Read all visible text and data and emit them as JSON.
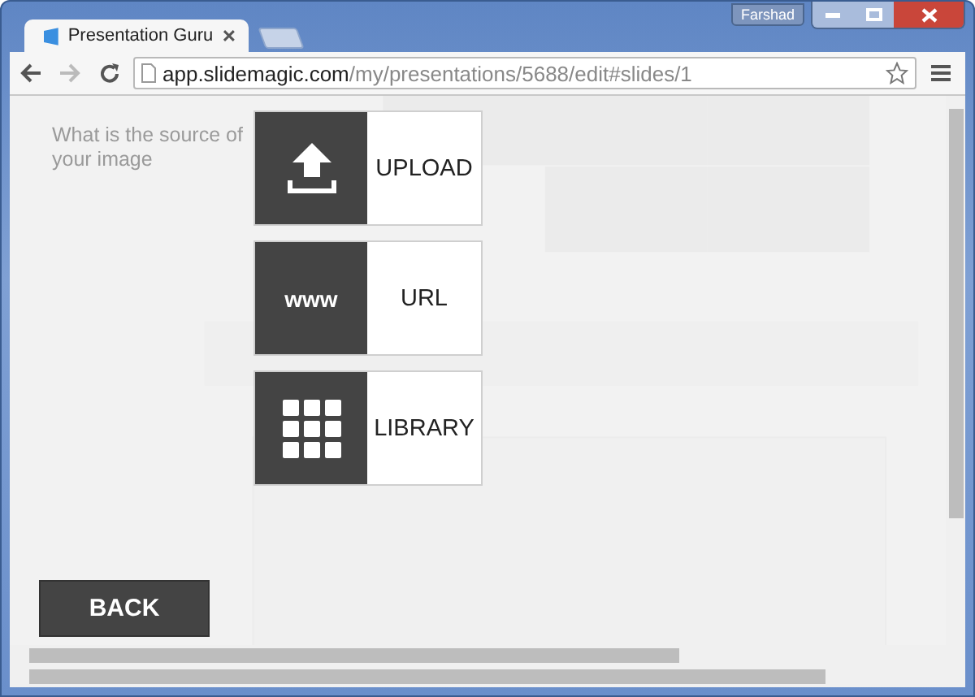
{
  "window": {
    "user": "Farshad"
  },
  "tabs": [
    {
      "label": "Presentation Guru",
      "selected": true
    }
  ],
  "address_bar": {
    "domain": "app.slidemagic.com",
    "path": "/my/presentations/5688/edit#slides/1"
  },
  "dialog": {
    "prompt": "What is the source of your image",
    "options": [
      {
        "kind": "upload",
        "label": "UPLOAD"
      },
      {
        "kind": "url",
        "label": "URL",
        "icon_text": "www"
      },
      {
        "kind": "library",
        "label": "LIBRARY"
      }
    ],
    "back_button": "BACK"
  }
}
